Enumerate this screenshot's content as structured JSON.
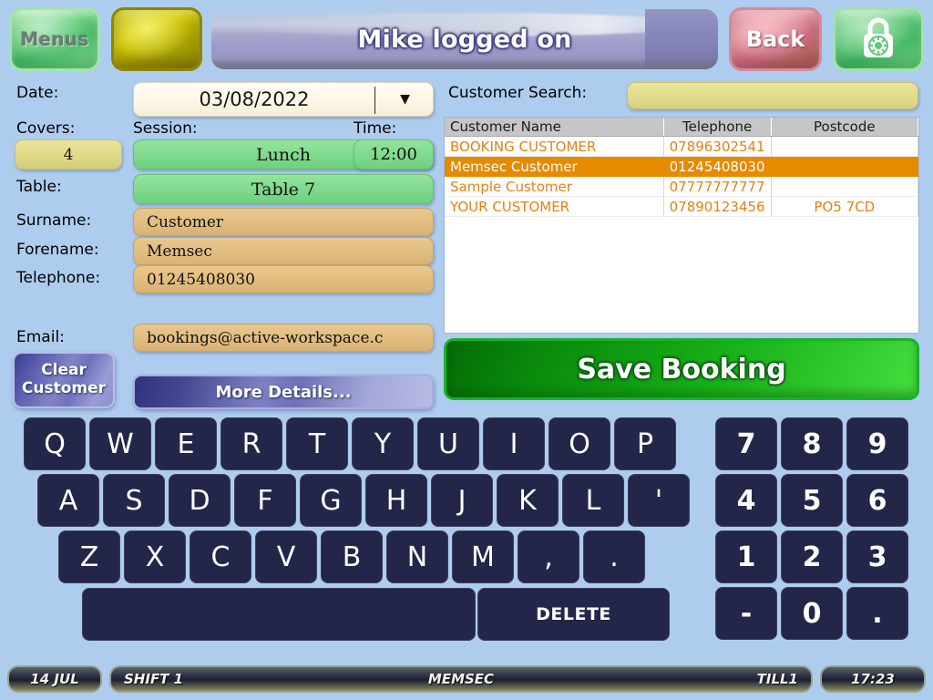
{
  "topbar": {
    "menus_label": "Menus",
    "yellow_button_label": "",
    "title": "Mike logged on",
    "back_label": "Back",
    "lock_icon": "padlock-icon"
  },
  "form": {
    "labels": {
      "date": "Date:",
      "covers": "Covers:",
      "session": "Session:",
      "time": "Time:",
      "table": "Table:",
      "surname": "Surname:",
      "forename": "Forename:",
      "telephone": "Telephone:",
      "email": "Email:"
    },
    "values": {
      "date": "03/08/2022",
      "covers": "4",
      "session": "Lunch",
      "time": "12:00",
      "table": "Table 7",
      "surname": "Customer",
      "forename": "Memsec",
      "telephone": "01245408030",
      "email": "bookings@active-workspace.c"
    },
    "date_dropdown_icon": "chevron-down-icon",
    "clear_customer_label_line1": "Clear",
    "clear_customer_label_line2": "Customer",
    "more_details_label": "More Details..."
  },
  "search": {
    "label": "Customer Search:",
    "value": "",
    "placeholder": ""
  },
  "customer_table": {
    "columns": [
      "Customer Name",
      "Telephone",
      "Postcode"
    ],
    "rows": [
      {
        "name": "BOOKING CUSTOMER",
        "telephone": "07896302541",
        "postcode": "",
        "selected": false
      },
      {
        "name": "Memsec Customer",
        "telephone": "01245408030",
        "postcode": "",
        "selected": true
      },
      {
        "name": "Sample Customer",
        "telephone": "07777777777",
        "postcode": "",
        "selected": false
      },
      {
        "name": "YOUR CUSTOMER",
        "telephone": "07890123456",
        "postcode": "PO5 7CD",
        "selected": false
      }
    ]
  },
  "save_booking_label": "Save Booking",
  "keyboard": {
    "row1": [
      "Q",
      "W",
      "E",
      "R",
      "T",
      "Y",
      "U",
      "I",
      "O",
      "P"
    ],
    "row2": [
      "A",
      "S",
      "D",
      "F",
      "G",
      "H",
      "J",
      "K",
      "L",
      "'"
    ],
    "row3": [
      "Z",
      "X",
      "C",
      "V",
      "B",
      "N",
      "M",
      ",",
      "."
    ],
    "space_label": "",
    "delete_label": "DELETE"
  },
  "numpad": {
    "rows": [
      [
        "7",
        "8",
        "9"
      ],
      [
        "4",
        "5",
        "6"
      ],
      [
        "1",
        "2",
        "3"
      ],
      [
        "-",
        "0",
        "."
      ]
    ]
  },
  "statusbar": {
    "date": "14 JUL",
    "shift": "SHIFT 1",
    "operator": "MEMSEC",
    "till": "TILL1",
    "time": "17:23"
  },
  "colors": {
    "background": "#aecdee",
    "key": "#232648",
    "selected_row": "#e68a00",
    "row_text": "#e08214",
    "save_green": "#12a012",
    "field_tan": "#e2bd80",
    "field_khaki": "#dfd986",
    "field_green": "#7ed98c"
  }
}
